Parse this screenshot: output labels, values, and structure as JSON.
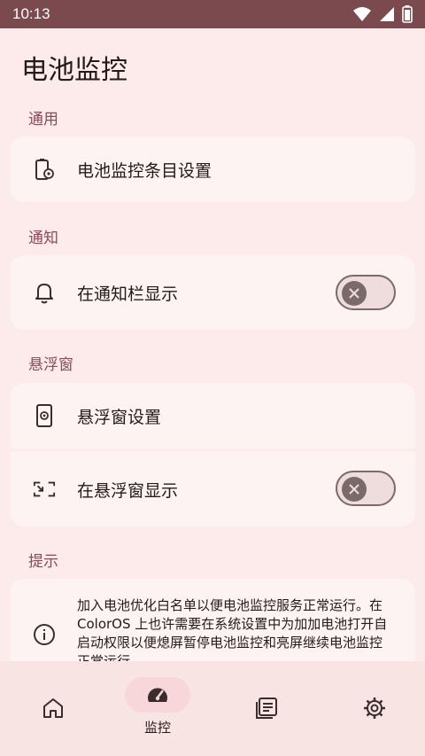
{
  "status_bar": {
    "time": "10:13"
  },
  "page": {
    "title": "电池监控"
  },
  "sections": {
    "general": {
      "header": "通用",
      "items": [
        {
          "label": "电池监控条目设置",
          "icon": "battery-settings-icon"
        }
      ]
    },
    "notification": {
      "header": "通知",
      "items": [
        {
          "label": "在通知栏显示",
          "icon": "bell-icon",
          "toggle": false
        }
      ]
    },
    "floating_window": {
      "header": "悬浮窗",
      "items": [
        {
          "label": "悬浮窗设置",
          "icon": "phone-settings-icon"
        },
        {
          "label": "在悬浮窗显示",
          "icon": "picture-in-picture-icon",
          "toggle": false
        }
      ]
    },
    "tips": {
      "header": "提示",
      "text": "加入电池优化白名单以便电池监控服务正常运行。在 ColorOS 上也许需要在系统设置中为加加电池打开自启动权限以便熄屏暂停电池监控和亮屏继续电池监控正常运行。"
    }
  },
  "bottom_nav": {
    "items": [
      {
        "name": "home",
        "icon": "home-icon",
        "label": ""
      },
      {
        "name": "monitor",
        "icon": "speedometer-icon",
        "label": "监控",
        "selected": true
      },
      {
        "name": "records",
        "icon": "list-icon",
        "label": ""
      },
      {
        "name": "settings",
        "icon": "gear-icon",
        "label": ""
      }
    ]
  },
  "colors": {
    "status_bar": "#7a4a4f",
    "background": "#fcebea",
    "card": "#fdf3f2",
    "section_header": "#8c4a55",
    "nav_selected_pill": "#f8d7db"
  }
}
